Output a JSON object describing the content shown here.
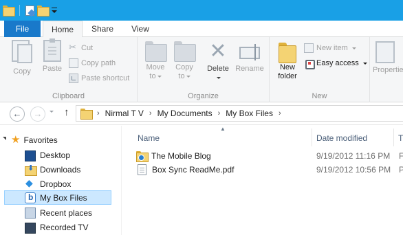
{
  "tabs": {
    "file": "File",
    "home": "Home",
    "share": "Share",
    "view": "View"
  },
  "ribbon": {
    "clipboard": {
      "label": "Clipboard",
      "copy": "Copy",
      "paste": "Paste",
      "cut": "Cut",
      "copy_path": "Copy path",
      "paste_shortcut": "Paste shortcut"
    },
    "organize": {
      "label": "Organize",
      "move_to_1": "Move",
      "move_to_2": "to",
      "copy_to_1": "Copy",
      "copy_to_2": "to",
      "delete": "Delete",
      "rename": "Rename"
    },
    "new": {
      "label": "New",
      "new_folder_1": "New",
      "new_folder_2": "folder",
      "new_item": "New item",
      "easy_access": "Easy access"
    },
    "open": {
      "properties": "Properties"
    }
  },
  "address": {
    "crumbs": [
      "Nirmal T V",
      "My Documents",
      "My Box Files"
    ]
  },
  "navpane": {
    "favorites": "Favorites",
    "items": [
      "Desktop",
      "Downloads",
      "Dropbox",
      "My Box Files",
      "Recent places",
      "Recorded TV"
    ]
  },
  "columns": {
    "name": "Name",
    "date_modified": "Date modified",
    "type": "T"
  },
  "files": [
    {
      "name": "The Mobile Blog",
      "date": "9/19/2012 11:16 PM",
      "type": "F"
    },
    {
      "name": "Box Sync ReadMe.pdf",
      "date": "9/19/2012 10:56 PM",
      "type": "P"
    }
  ]
}
